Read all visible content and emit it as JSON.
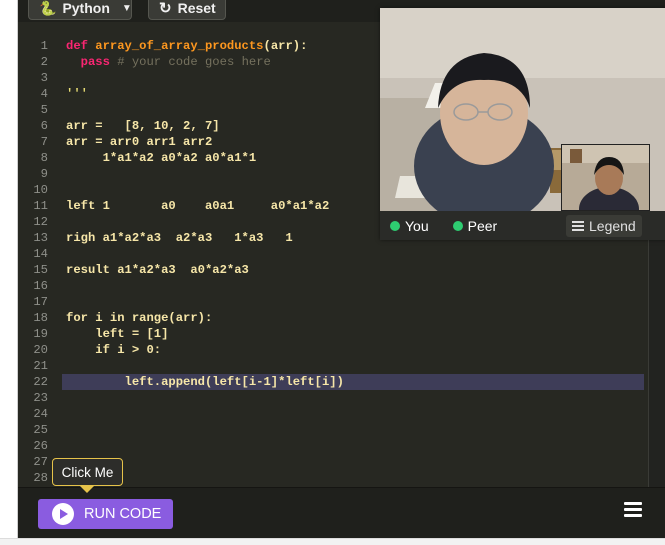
{
  "toolbar": {
    "language_label": "Python",
    "language_caret": "▼",
    "reset_label": "Reset",
    "reset_icon": "↻"
  },
  "editor": {
    "lines": [
      {
        "num": "1"
      },
      {
        "num": "2"
      },
      {
        "num": "3"
      },
      {
        "num": "4"
      },
      {
        "num": "5"
      },
      {
        "num": "6"
      },
      {
        "num": "7"
      },
      {
        "num": "8"
      },
      {
        "num": "9"
      },
      {
        "num": "10"
      },
      {
        "num": "11"
      },
      {
        "num": "12"
      },
      {
        "num": "13"
      },
      {
        "num": "14"
      },
      {
        "num": "15"
      },
      {
        "num": "16"
      },
      {
        "num": "17"
      },
      {
        "num": "18"
      },
      {
        "num": "19"
      },
      {
        "num": "20"
      },
      {
        "num": "21"
      },
      {
        "num": "22"
      },
      {
        "num": "23"
      },
      {
        "num": "24"
      },
      {
        "num": "25"
      },
      {
        "num": "26"
      },
      {
        "num": "27"
      },
      {
        "num": "28"
      }
    ],
    "code": {
      "l1_kw": "def",
      "l1_fn": "array_of_array_products",
      "l1_rest": "(arr):",
      "l2_kw": "pass",
      "l2_cm": "# your code goes here",
      "l4": "'''",
      "l6": "arr =   [8, 10, 2, 7]",
      "l7": "arr = arr0 arr1 arr2",
      "l8": "     1*a1*a2 a0*a2 a0*a1*1",
      "l11": "left 1       a0    a0a1     a0*a1*a2",
      "l13": "righ a1*a2*a3  a2*a3   1*a3   1",
      "l15": "result a1*a2*a3  a0*a2*a3",
      "l18": "for i in range(arr):",
      "l19": "    left = [1]",
      "l20": "    if i > 0:",
      "l22": "        left.append(left[i-1]*left[i])"
    }
  },
  "video": {
    "you_label": "You",
    "peer_label": "Peer",
    "legend_label": "Legend",
    "status_color": "#2ecc71"
  },
  "bottom": {
    "run_label": "RUN CODE",
    "tooltip_label": "Click Me",
    "accent_color": "#8a5ce0"
  }
}
